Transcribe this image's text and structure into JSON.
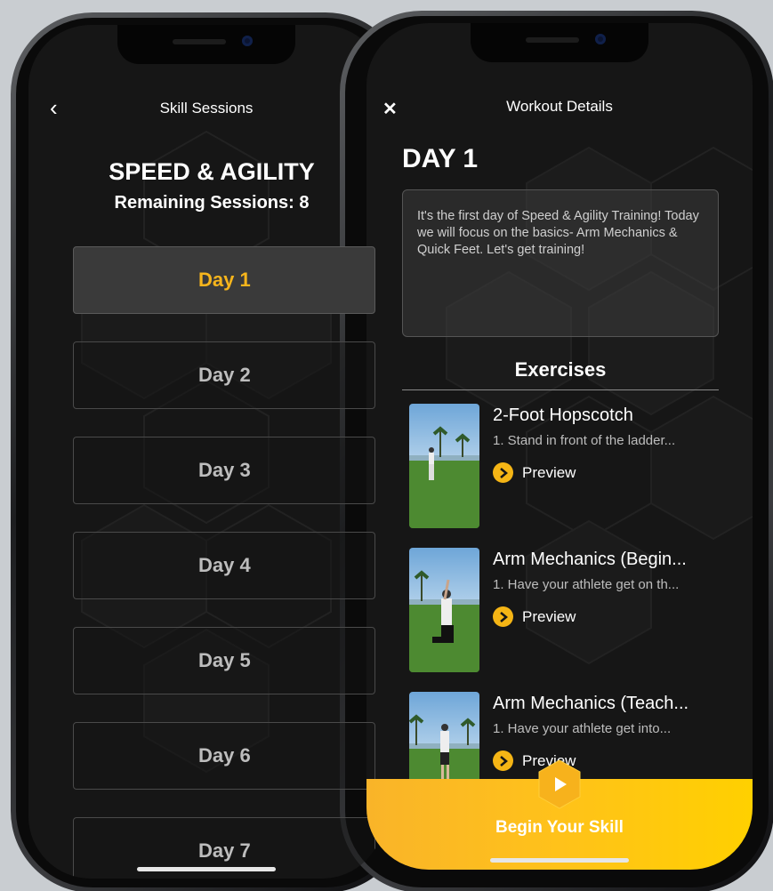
{
  "left_screen": {
    "nav_title": "Skill Sessions",
    "back_icon": "chevron-left-icon",
    "program_title": "SPEED & AGILITY",
    "remaining_sessions": "Remaining Sessions: 8",
    "days": [
      {
        "label": "Day 1",
        "selected": true
      },
      {
        "label": "Day 2",
        "selected": false
      },
      {
        "label": "Day 3",
        "selected": false
      },
      {
        "label": "Day 4",
        "selected": false
      },
      {
        "label": "Day 5",
        "selected": false
      },
      {
        "label": "Day 6",
        "selected": false
      },
      {
        "label": "Day 7",
        "selected": false
      }
    ]
  },
  "right_screen": {
    "nav_title": "Workout Details",
    "close_icon": "close-icon",
    "day_title": "DAY 1",
    "description": "It's the first day of Speed & Agility Training! Today we will focus on the basics- Arm Mechanics & Quick Feet. Let's get training!",
    "exercises_heading": "Exercises",
    "exercises": [
      {
        "title": "2-Foot Hopscotch",
        "subtitle": "1. Stand in front of the ladder...",
        "preview_label": "Preview"
      },
      {
        "title": "Arm Mechanics (Begin...",
        "subtitle": "1. Have your athlete get on th...",
        "preview_label": "Preview"
      },
      {
        "title": "Arm Mechanics (Teach...",
        "subtitle": "1. Have your athlete get into...",
        "preview_label": "Preview"
      }
    ],
    "cta_label": "Begin Your Skill",
    "play_icon": "play-icon"
  },
  "colors": {
    "accent": "#f7b51c",
    "background": "#161616",
    "cta_gradient_start": "#f9b429",
    "cta_gradient_end": "#ffd000"
  }
}
